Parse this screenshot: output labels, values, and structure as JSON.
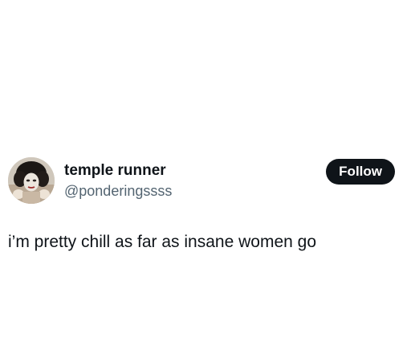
{
  "tweet": {
    "author": {
      "display_name": "temple runner",
      "handle": "@ponderingssss",
      "avatar_icon": "avatar-photo-portrait"
    },
    "follow_label": "Follow",
    "text": "i’m pretty chill as far as insane women go"
  },
  "colors": {
    "text_primary": "#0f1419",
    "text_secondary": "#536471",
    "button_bg": "#0f1419",
    "button_text": "#ffffff",
    "background": "#ffffff"
  }
}
